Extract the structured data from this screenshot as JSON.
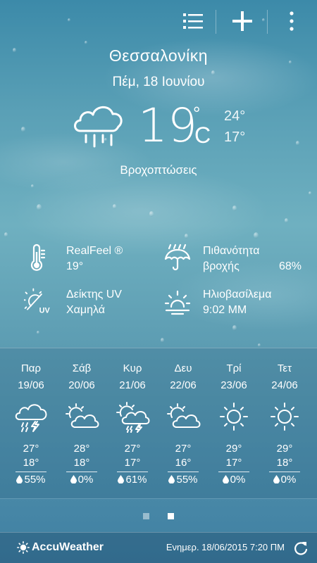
{
  "toolbar": {
    "icons": [
      "list-icon",
      "plus-icon",
      "more-vertical-icon"
    ]
  },
  "location": {
    "city": "Θεσσαλονίκη",
    "date": "Πέμ, 18 Ιουνίου"
  },
  "current": {
    "icon": "rain-cloud-icon",
    "temp": "19",
    "degree": "°",
    "unit": "C",
    "high": "24°",
    "low": "17°",
    "condition": "Βροχοπτώσεις"
  },
  "details": {
    "realfeel_label": "RealFeel ®",
    "realfeel_value": "19°",
    "rain_chance_label_1": "Πιθανότητα",
    "rain_chance_label_2": "βροχής",
    "rain_chance_value": "68%",
    "uv_label": "Δείκτης UV",
    "uv_value": "Χαμηλά",
    "sunset_label": "Ηλιοβασίλεμα",
    "sunset_value": "9:02 ΜΜ"
  },
  "forecast": [
    {
      "day": "Παρ",
      "date": "19/06",
      "icon": "thunder-rain-icon",
      "high": "27°",
      "low": "18°",
      "precip": "55%"
    },
    {
      "day": "Σάβ",
      "date": "20/06",
      "icon": "partly-cloudy-icon",
      "high": "28°",
      "low": "18°",
      "precip": "0%"
    },
    {
      "day": "Κυρ",
      "date": "21/06",
      "icon": "sun-thunder-rain-icon",
      "high": "27°",
      "low": "17°",
      "precip": "61%"
    },
    {
      "day": "Δευ",
      "date": "22/06",
      "icon": "partly-cloudy-icon",
      "high": "27°",
      "low": "16°",
      "precip": "55%"
    },
    {
      "day": "Τρί",
      "date": "23/06",
      "icon": "sunny-icon",
      "high": "29°",
      "low": "17°",
      "precip": "0%"
    },
    {
      "day": "Τετ",
      "date": "24/06",
      "icon": "sunny-icon",
      "high": "29°",
      "low": "18°",
      "precip": "0%"
    }
  ],
  "pager": {
    "pages": 2,
    "active": 2
  },
  "footer": {
    "brand": "AccuWeather",
    "updated": "Ενημερ. 18/06/2015 7:20 ΠΜ"
  }
}
